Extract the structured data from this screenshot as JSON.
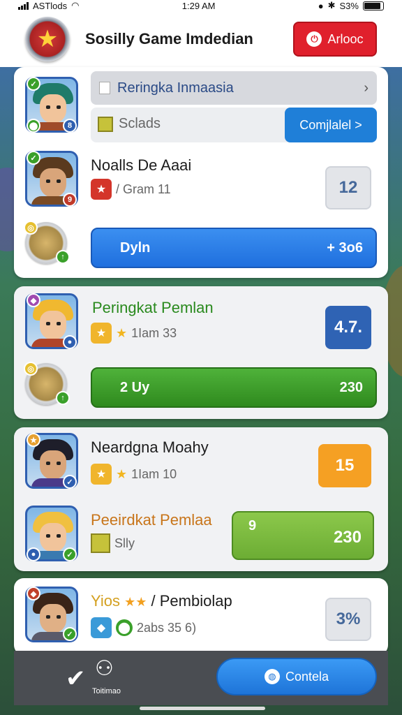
{
  "status_bar": {
    "carrier": "ASTlods",
    "time": "1:29 AM",
    "battery": "S3%"
  },
  "header": {
    "title": "Sosilly Game Imdedian",
    "action_label": "Arlooc"
  },
  "top_card": {
    "search_text": "Reringka Inmaasia",
    "tab_label": "Sclads",
    "tab_button": "Comjlalel >",
    "player": {
      "name": "Noalls De Aaai",
      "detail": "/ Gram 11",
      "score": "12"
    },
    "bar": {
      "left": "Dyln",
      "right": "+ 3o6"
    }
  },
  "green_card": {
    "player": {
      "name": "Peringkat Pemlan",
      "detail": "1Iam 33",
      "score": "4.7."
    },
    "bar": {
      "left": "2 Uy",
      "right": "230"
    }
  },
  "orange_card": {
    "player": {
      "name": "Neardgna Moahy",
      "detail": "1Iam 10",
      "score": "15"
    },
    "second": {
      "name": "Peeirdkat Pemlaa",
      "detail": "Slly",
      "bar_left": "9",
      "bar_right": "230"
    }
  },
  "last_card": {
    "name_prefix": "Yios",
    "name": "/ Pembiolap",
    "detail": "2abs 35  6)",
    "score": "3%"
  },
  "bottom_bar": {
    "label": "Toitimao",
    "button": "Contela"
  }
}
